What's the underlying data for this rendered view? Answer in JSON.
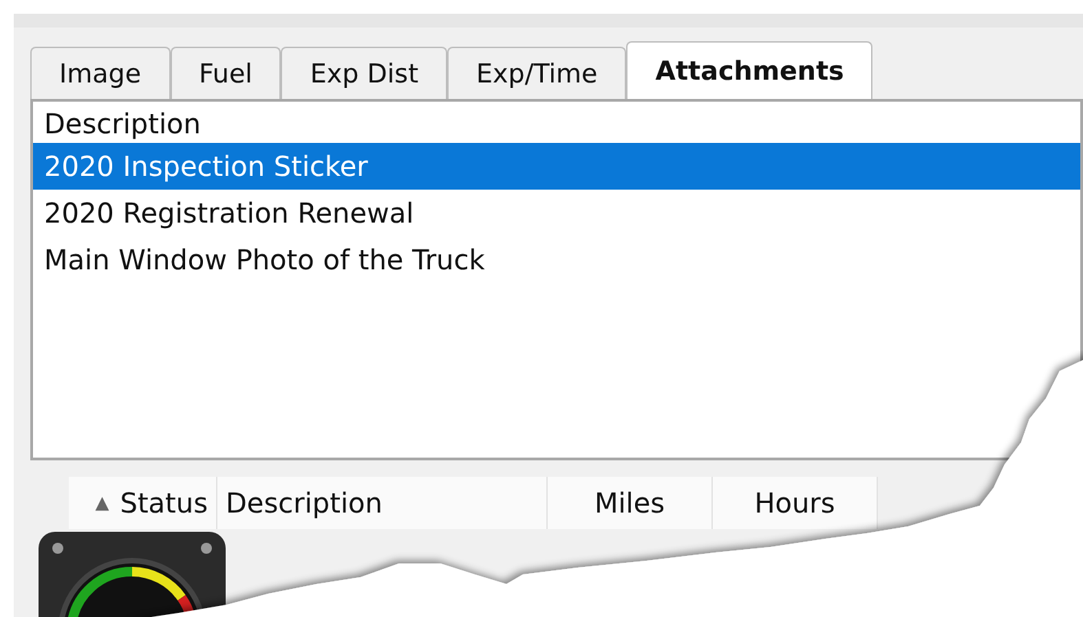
{
  "tabs": [
    {
      "label": "Image",
      "selected": false
    },
    {
      "label": "Fuel",
      "selected": false
    },
    {
      "label": "Exp Dist",
      "selected": false
    },
    {
      "label": "Exp/Time",
      "selected": false
    },
    {
      "label": "Attachments",
      "selected": true
    }
  ],
  "attachments": {
    "header": "Description",
    "rows": [
      {
        "description": "2020 Inspection Sticker",
        "selected": true
      },
      {
        "description": "2020 Registration Renewal",
        "selected": false
      },
      {
        "description": "Main Window Photo of the Truck",
        "selected": false
      }
    ]
  },
  "grid": {
    "sort_indicator": "▲",
    "columns": [
      "Status",
      "Description",
      "Miles",
      "Hours"
    ]
  }
}
